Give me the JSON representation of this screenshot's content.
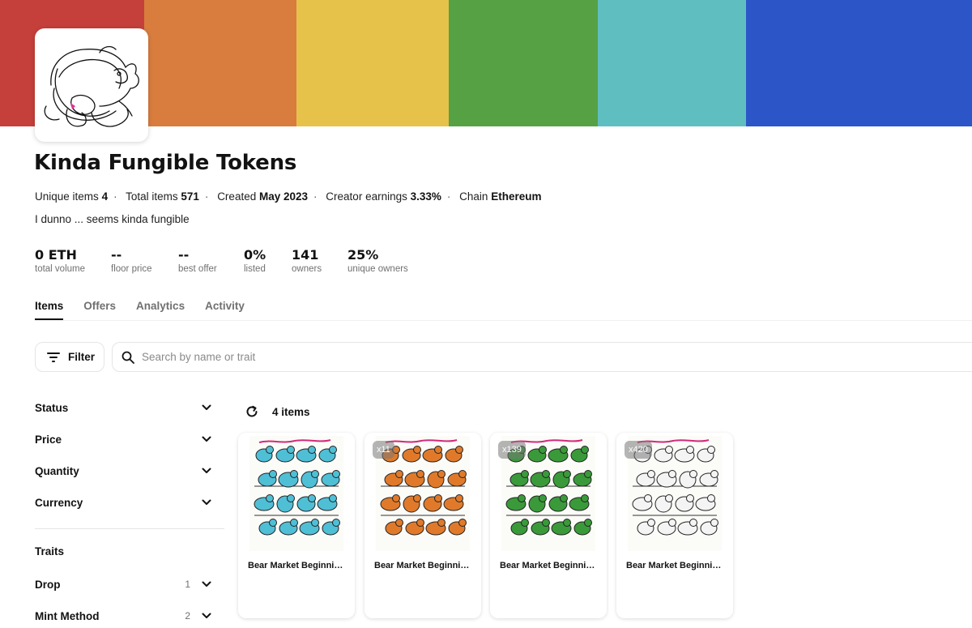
{
  "banner": {
    "colors": [
      "#c5403a",
      "#d87d3e",
      "#e6c24a",
      "#57a145",
      "#5fbfc0",
      "#2c56c8"
    ]
  },
  "collection": {
    "name": "Kinda Fungible Tokens",
    "meta": [
      {
        "label": "Unique items",
        "value": "4"
      },
      {
        "label": "Total items",
        "value": "571"
      },
      {
        "label": "Created",
        "value": "May 2023"
      },
      {
        "label": "Creator earnings",
        "value": "3.33%"
      },
      {
        "label": "Chain",
        "value": "Ethereum"
      }
    ],
    "description": "I dunno ... seems kinda fungible",
    "stats": [
      {
        "value": "0 ETH",
        "label": "total volume"
      },
      {
        "value": "--",
        "label": "floor price"
      },
      {
        "value": "--",
        "label": "best offer"
      },
      {
        "value": "0%",
        "label": "listed"
      },
      {
        "value": "141",
        "label": "owners"
      },
      {
        "value": "25%",
        "label": "unique owners"
      }
    ]
  },
  "tabs": [
    {
      "label": "Items",
      "active": true
    },
    {
      "label": "Offers",
      "active": false
    },
    {
      "label": "Analytics",
      "active": false
    },
    {
      "label": "Activity",
      "active": false
    }
  ],
  "toolbar": {
    "filter_label": "Filter",
    "search_placeholder": "Search by name or trait",
    "icons": {
      "filter": "filter-lines-icon",
      "search": "search-icon",
      "refresh": "refresh-icon"
    }
  },
  "sidebar": {
    "filters": [
      {
        "label": "Status"
      },
      {
        "label": "Price"
      },
      {
        "label": "Quantity"
      },
      {
        "label": "Currency"
      }
    ],
    "traits_label": "Traits",
    "traits": [
      {
        "label": "Drop",
        "count": "1"
      },
      {
        "label": "Mint Method",
        "count": "2"
      }
    ]
  },
  "items": {
    "count_label": "4 items",
    "cards": [
      {
        "name": "Bear Market Beginnings",
        "badge": "",
        "color": "#4fbfd6"
      },
      {
        "name": "Bear Market Beginnings",
        "badge": "x11",
        "color": "#e07a2a"
      },
      {
        "name": "Bear Market Beginnings",
        "badge": "x139",
        "color": "#3a9a3a"
      },
      {
        "name": "Bear Market Beginnings",
        "badge": "x420",
        "color": "#f4f4f4"
      }
    ]
  }
}
